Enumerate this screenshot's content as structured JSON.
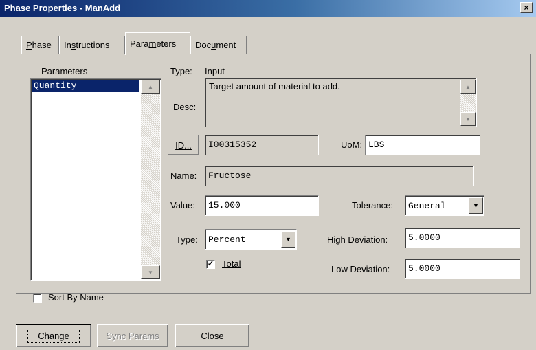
{
  "window": {
    "title": "Phase Properties - ManAdd",
    "close_glyph": "×"
  },
  "tabs": [
    {
      "label": "Phase",
      "accel": "P",
      "rest": "hase"
    },
    {
      "label": "Instructions",
      "pre": "In",
      "accel": "s",
      "rest": "tructions"
    },
    {
      "label": "Parameters",
      "pre": "Para",
      "accel": "m",
      "rest": "eters"
    },
    {
      "label": "Document",
      "pre": "Doc",
      "accel": "u",
      "rest": "ment"
    }
  ],
  "parameters": {
    "heading": "Parameters",
    "items": [
      "Quantity"
    ],
    "sort_by_name": {
      "label": "Sort By Name",
      "checked": false
    }
  },
  "details": {
    "type_label": "Type:",
    "type_value": "Input",
    "desc_label": "Desc:",
    "desc_value": "Target amount of material to add.",
    "id_button": "ID...",
    "id_value": "I00315352",
    "uom_label": "UoM:",
    "uom_value": "LBS",
    "name_label": "Name:",
    "name_value": "Fructose",
    "value_label": "Value:",
    "value_value": "15.000",
    "tolerance_label": "Tolerance:",
    "tolerance_value": "General",
    "type2_label": "Type:",
    "type2_value": "Percent",
    "total_label": "Total",
    "total_checked": true,
    "high_dev_label": "High Deviation:",
    "high_dev_value": "5.0000",
    "low_dev_label": "Low Deviation:",
    "low_dev_value": "5.0000"
  },
  "buttons": {
    "change": "Change",
    "sync_params": "Sync Params",
    "close": "Close"
  },
  "colors": {
    "titlebar": "#0a246a",
    "selection": "#0a246a",
    "face": "#d4d0c8"
  }
}
